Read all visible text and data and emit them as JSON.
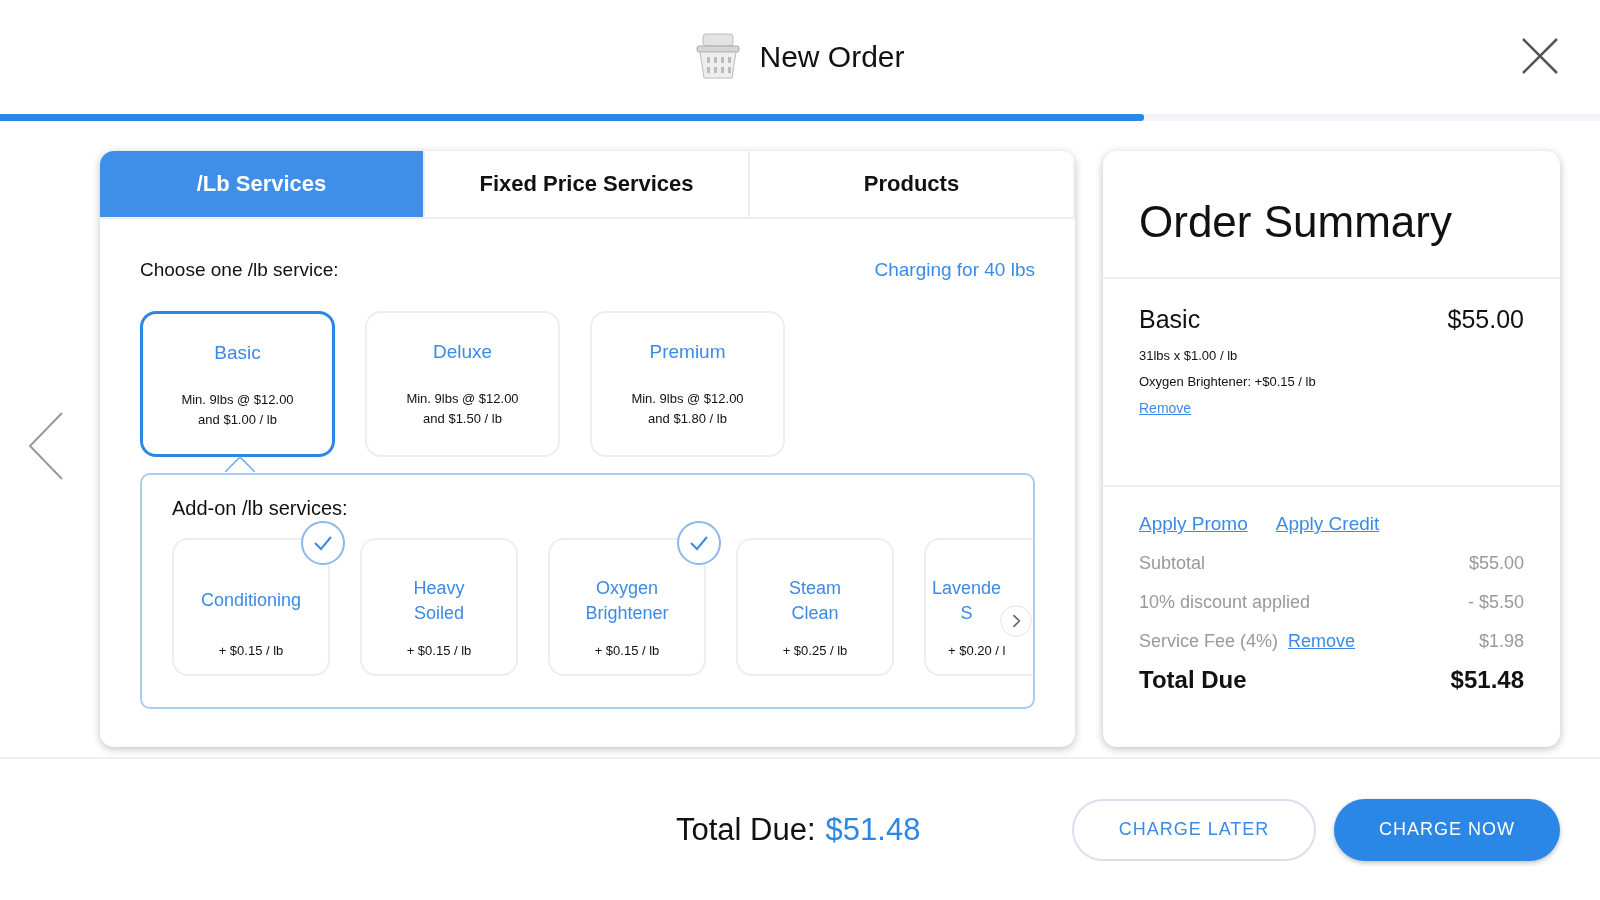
{
  "header": {
    "title": "New Order",
    "progress": {
      "level": 0.715
    }
  },
  "tabs": [
    {
      "label": "/Lb Services",
      "selected": true
    },
    {
      "label": "Fixed Price Services",
      "selected": false
    },
    {
      "label": "Products",
      "selected": false
    }
  ],
  "services": {
    "prompt": "Choose one /lb service:",
    "charging": "Charging for 40 lbs",
    "items": [
      {
        "name": "Basic",
        "lines": [
          "Min. 9lbs @ $12.00",
          "and $1.00 / lb"
        ],
        "selected": true
      },
      {
        "name": "Deluxe",
        "lines": [
          "Min. 9lbs @ $12.00",
          "and $1.50 / lb"
        ],
        "selected": false
      },
      {
        "name": "Premium",
        "lines": [
          "Min. 9lbs @ $12.00",
          "and $1.80 / lb"
        ],
        "selected": false
      }
    ]
  },
  "addons": {
    "title": "Add-on /lb services:",
    "items": [
      {
        "name": [
          "Conditioning"
        ],
        "price": "+ $0.15 / lb",
        "checked": true
      },
      {
        "name": [
          "Heavy",
          "Soiled"
        ],
        "price": "+ $0.15 / lb",
        "checked": false
      },
      {
        "name": [
          "Oxygen",
          "Brightener"
        ],
        "price": "+ $0.15 / lb",
        "checked": true
      },
      {
        "name": [
          "Steam",
          "Clean"
        ],
        "price": "+ $0.25 / lb",
        "checked": false
      },
      {
        "name": [
          "Lavende",
          "S"
        ],
        "price": "+ $0.20 / l",
        "checked": false
      }
    ]
  },
  "summary": {
    "title": "Order Summary",
    "item": {
      "name": "Basic",
      "amount": "$55.00",
      "details": [
        "31lbs x $1.00 / lb",
        "Oxygen Brightener: +$0.15 / lb"
      ],
      "remove": "Remove"
    },
    "links": [
      "Apply Promo",
      "Apply Credit"
    ],
    "lines": [
      {
        "label": "Subtotal",
        "amount": "$55.00"
      },
      {
        "label": "10% discount applied",
        "amount": "- $5.50"
      },
      {
        "label": "Service Fee (4%)",
        "link": "Remove",
        "amount": "$1.98"
      }
    ],
    "total": {
      "label": "Total Due",
      "amount": "$51.48"
    }
  },
  "footer": {
    "label": "Total Due:",
    "amount": "$51.48",
    "buttons": [
      {
        "label": "CHARGE LATER",
        "kind": "outline"
      },
      {
        "label": "CHARGE NOW",
        "kind": "filled"
      }
    ]
  }
}
